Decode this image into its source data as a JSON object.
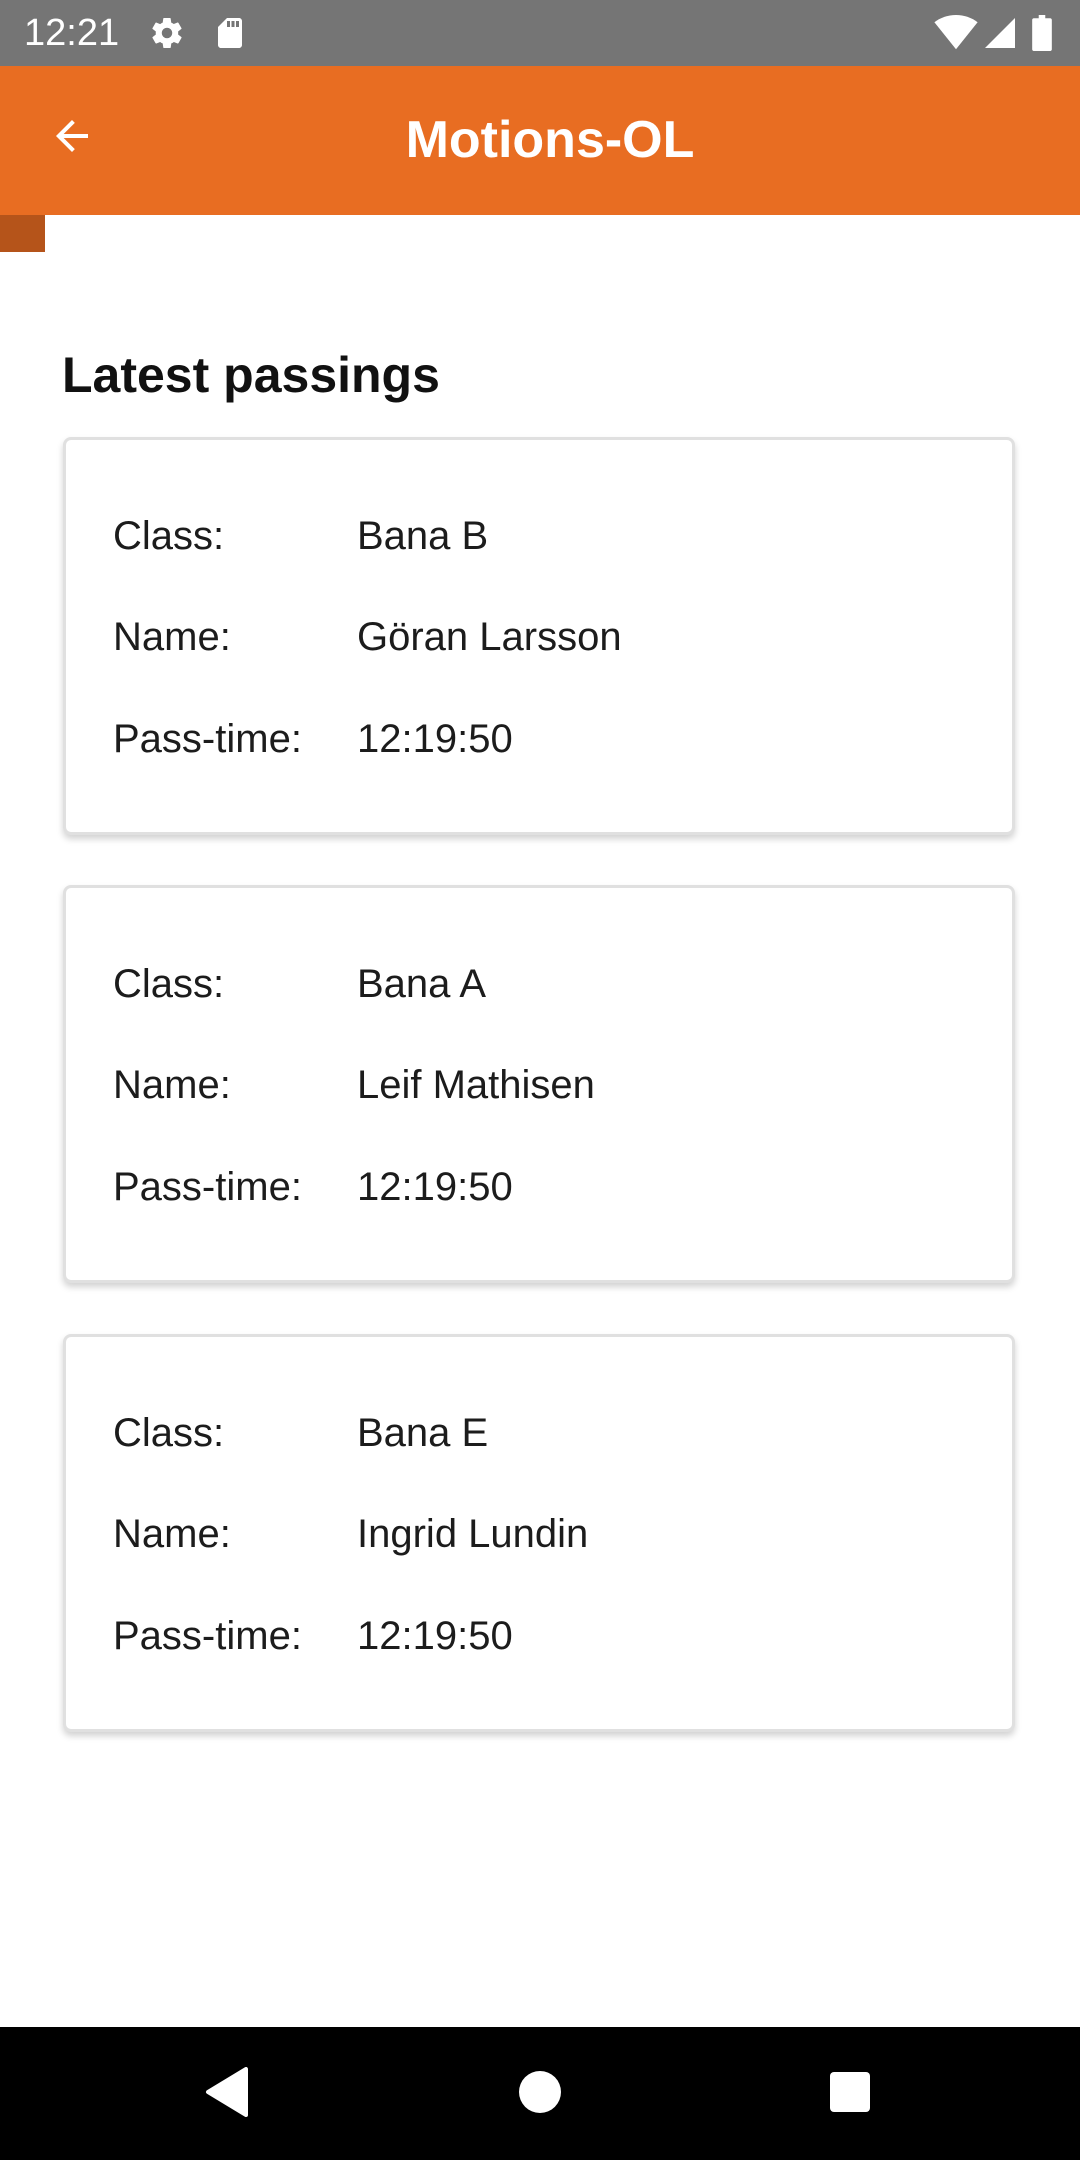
{
  "status_bar": {
    "time": "12:21",
    "icons": [
      "settings-icon",
      "sd-card-icon",
      "wifi-icon",
      "cell-signal-icon",
      "battery-icon"
    ]
  },
  "app_bar": {
    "title": "Motions-OL",
    "back_icon": "arrow-left-icon",
    "color": "#e86d22"
  },
  "main": {
    "section_title": "Latest passings",
    "passings": [
      {
        "class_label": "Class:",
        "class_value": "Bana B",
        "name_label": "Name:",
        "name_value": "Göran Larsson",
        "time_label": "Pass-time:",
        "time_value": "12:19:50"
      },
      {
        "class_label": "Class:",
        "class_value": "Bana A",
        "name_label": "Name:",
        "name_value": "Leif Mathisen",
        "time_label": "Pass-time:",
        "time_value": "12:19:50"
      },
      {
        "class_label": "Class:",
        "class_value": "Bana E",
        "name_label": "Name:",
        "name_value": "Ingrid Lundin",
        "time_label": "Pass-time:",
        "time_value": "12:19:50"
      }
    ]
  },
  "nav_bar": {
    "icons": [
      "back-triangle-icon",
      "home-circle-icon",
      "recents-square-icon"
    ]
  }
}
